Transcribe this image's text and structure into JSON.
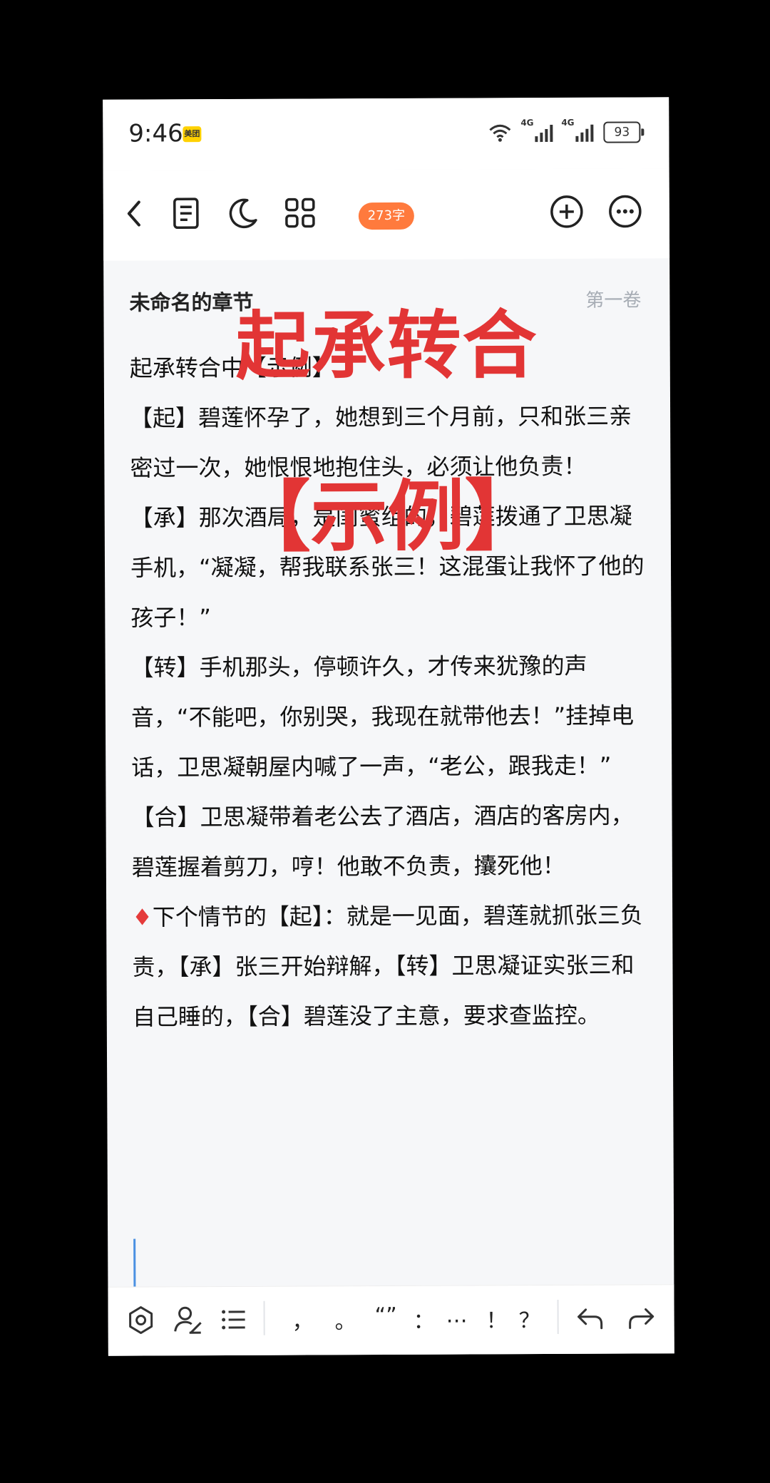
{
  "status_bar": {
    "time": "9:46",
    "app_tag": "美团",
    "signal1_label": "4G",
    "signal2_label": "4G",
    "battery": "93"
  },
  "toolbar": {
    "word_count": "273字",
    "accent": "#ff7a3d"
  },
  "document": {
    "title": "未命名的章节",
    "volume": "第一卷",
    "paragraphs": [
      "起承转合中【示例】",
      "【起】碧莲怀孕了，她想到三个月前，只和张三亲密过一次，她恨恨地抱住头，必须让他负责！",
      "【承】那次酒局，是闺蜜组的，碧莲拨通了卫思凝手机，“凝凝，帮我联系张三！这混蛋让我怀了他的孩子！”",
      "【转】手机那头，停顿许久，才传来犹豫的声音，“不能吧，你别哭，我现在就带他去！”挂掉电话，卫思凝朝屋内喊了一声，“老公，跟我走！”",
      "【合】卫思凝带着老公去了酒店，酒店的客房内，碧莲握着剪刀，哼！他敢不负责，攮死他！"
    ],
    "diamond": "♦",
    "last_paragraph": "下个情节的【起】：就是一见面，碧莲就抓张三负责，【承】张三开始辩解，【转】卫思凝证实张三和自己睡的，【合】碧莲没了主意，要求查监控。"
  },
  "overlay": {
    "title": "起承转合",
    "subtitle": "【示例】",
    "color": "#e23535"
  },
  "bottom_bar": {
    "punctuation": [
      "，",
      "。",
      "“”",
      "：",
      "…",
      "！",
      "？"
    ]
  }
}
